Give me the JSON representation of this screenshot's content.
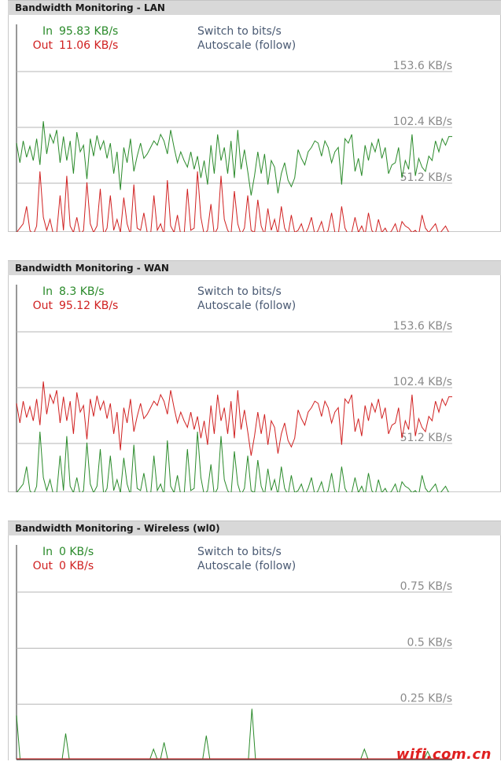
{
  "panels": [
    {
      "title": "Bandwidth Monitoring - LAN",
      "in_label": "In",
      "in_value": "95.83 KB/s",
      "out_label": "Out",
      "out_value": "11.06 KB/s",
      "switch_link": "Switch to bits/s",
      "autoscale_link": "Autoscale (follow)",
      "chart_data": {
        "type": "line",
        "yticks": [
          {
            "value": 51.2,
            "label": "51.2 KB/s"
          },
          {
            "value": 102.4,
            "label": "102.4 KB/s"
          },
          {
            "value": 153.6,
            "label": "153.6 KB/s"
          }
        ],
        "ylim": [
          0,
          153.6
        ],
        "series": [
          {
            "name": "In",
            "color": "#2a8a2a",
            "values": [
              88,
              70,
              90,
              75,
              85,
              72,
              92,
              68,
              108,
              78,
              96,
              88,
              100,
              70,
              94,
              72,
              90,
              60,
              98,
              80,
              86,
              55,
              92,
              76,
              95,
              82,
              90,
              74,
              88,
              60,
              80,
              45,
              84,
              70,
              92,
              62,
              76,
              88,
              74,
              78,
              84,
              90,
              86,
              96,
              90,
              78,
              100,
              84,
              70,
              80,
              72,
              66,
              80,
              64,
              76,
              56,
              72,
              50,
              86,
              60,
              96,
              72,
              84,
              60,
              90,
              56,
              100,
              64,
              82,
              62,
              40,
              58,
              80,
              60,
              78,
              50,
              72,
              66,
              42,
              60,
              70,
              54,
              48,
              56,
              82,
              74,
              68,
              80,
              84,
              90,
              88,
              76,
              90,
              84,
              70,
              80,
              84,
              50,
              92,
              88,
              96,
              62,
              74,
              58,
              86,
              72,
              88,
              80,
              92,
              74,
              84,
              60,
              68,
              70,
              84,
              56,
              72,
              64,
              96,
              58,
              74,
              66,
              62,
              76,
              72,
              90,
              80,
              92,
              86,
              94,
              94
            ]
          },
          {
            "name": "Out",
            "color": "#d02020",
            "values": [
              6,
              10,
              14,
              30,
              8,
              4,
              12,
              62,
              20,
              8,
              18,
              4,
              6,
              40,
              8,
              58,
              12,
              6,
              20,
              4,
              8,
              52,
              14,
              6,
              12,
              46,
              4,
              10,
              40,
              8,
              18,
              6,
              38,
              14,
              4,
              50,
              10,
              8,
              24,
              6,
              4,
              40,
              8,
              14,
              4,
              54,
              12,
              6,
              22,
              4,
              4,
              46,
              8,
              10,
              62,
              20,
              4,
              8,
              32,
              4,
              10,
              58,
              18,
              8,
              4,
              44,
              14,
              4,
              10,
              40,
              8,
              6,
              36,
              12,
              4,
              28,
              8,
              18,
              4,
              30,
              10,
              4,
              22,
              6,
              8,
              14,
              4,
              10,
              20,
              4,
              8,
              16,
              4,
              8,
              24,
              6,
              4,
              30,
              10,
              4,
              6,
              20,
              6,
              12,
              4,
              24,
              8,
              4,
              18,
              6,
              10,
              4,
              8,
              14,
              4,
              16,
              12,
              10,
              6,
              8,
              4,
              22,
              10,
              6,
              10,
              14,
              4,
              8,
              12,
              6,
              4
            ]
          }
        ]
      }
    },
    {
      "title": "Bandwidth Monitoring - WAN",
      "in_label": "In",
      "in_value": "8.3 KB/s",
      "out_label": "Out",
      "out_value": "95.12 KB/s",
      "switch_link": "Switch to bits/s",
      "autoscale_link": "Autoscale (follow)",
      "chart_data": {
        "type": "line",
        "yticks": [
          {
            "value": 51.2,
            "label": "51.2 KB/s"
          },
          {
            "value": 102.4,
            "label": "102.4 KB/s"
          },
          {
            "value": 153.6,
            "label": "153.6 KB/s"
          }
        ],
        "ylim": [
          0,
          153.6
        ],
        "series": [
          {
            "name": "In",
            "color": "#2a8a2a",
            "values": [
              6,
              10,
              14,
              30,
              8,
              4,
              12,
              62,
              20,
              8,
              18,
              4,
              6,
              40,
              8,
              58,
              12,
              6,
              20,
              4,
              8,
              52,
              14,
              6,
              12,
              46,
              4,
              10,
              40,
              8,
              18,
              6,
              38,
              14,
              4,
              50,
              10,
              8,
              24,
              6,
              4,
              40,
              8,
              14,
              4,
              54,
              12,
              6,
              22,
              4,
              4,
              46,
              8,
              10,
              62,
              20,
              4,
              8,
              32,
              4,
              10,
              58,
              18,
              8,
              4,
              44,
              14,
              4,
              10,
              40,
              8,
              6,
              36,
              12,
              4,
              28,
              8,
              18,
              4,
              30,
              10,
              4,
              22,
              6,
              8,
              14,
              4,
              10,
              20,
              4,
              8,
              16,
              4,
              8,
              24,
              6,
              4,
              30,
              10,
              4,
              6,
              20,
              6,
              12,
              4,
              24,
              8,
              4,
              18,
              6,
              10,
              4,
              8,
              14,
              4,
              16,
              12,
              10,
              6,
              8,
              4,
              22,
              10,
              6,
              10,
              14,
              4,
              8,
              12,
              6,
              4
            ]
          },
          {
            "name": "Out",
            "color": "#d02020",
            "values": [
              88,
              70,
              90,
              75,
              85,
              72,
              92,
              68,
              108,
              78,
              96,
              88,
              100,
              70,
              94,
              72,
              90,
              60,
              98,
              80,
              86,
              55,
              92,
              76,
              95,
              82,
              90,
              74,
              88,
              60,
              80,
              45,
              84,
              70,
              92,
              62,
              76,
              88,
              74,
              78,
              84,
              90,
              86,
              96,
              90,
              78,
              100,
              84,
              70,
              80,
              72,
              66,
              80,
              64,
              76,
              56,
              72,
              50,
              86,
              60,
              96,
              72,
              84,
              60,
              90,
              56,
              100,
              64,
              82,
              62,
              40,
              58,
              80,
              60,
              78,
              50,
              72,
              66,
              42,
              60,
              70,
              54,
              48,
              56,
              82,
              74,
              68,
              80,
              84,
              90,
              88,
              76,
              90,
              84,
              70,
              80,
              84,
              50,
              92,
              88,
              96,
              62,
              74,
              58,
              86,
              72,
              88,
              80,
              92,
              74,
              84,
              60,
              68,
              70,
              84,
              56,
              72,
              64,
              96,
              58,
              74,
              66,
              62,
              76,
              72,
              90,
              80,
              92,
              86,
              94,
              94
            ]
          }
        ]
      }
    },
    {
      "title": "Bandwidth Monitoring - Wireless (wl0)",
      "in_label": "In",
      "in_value": "0 KB/s",
      "out_label": "Out",
      "out_value": "0 KB/s",
      "switch_link": "Switch to bits/s",
      "autoscale_link": "Autoscale (follow)",
      "chart_data": {
        "type": "line",
        "yticks": [
          {
            "value": 0.25,
            "label": "0.25 KB/s"
          },
          {
            "value": 0.5,
            "label": "0.5 KB/s"
          },
          {
            "value": 0.75,
            "label": "0.75 KB/s"
          }
        ],
        "ylim": [
          0,
          0.75
        ],
        "series": [
          {
            "name": "In",
            "color": "#2a8a2a",
            "values": [
              0.2,
              0,
              0,
              0,
              0,
              0,
              0,
              0,
              0,
              0,
              0,
              0,
              0,
              0,
              0.12,
              0,
              0,
              0,
              0,
              0,
              0,
              0,
              0,
              0,
              0,
              0,
              0,
              0,
              0,
              0,
              0,
              0,
              0,
              0,
              0,
              0,
              0,
              0,
              0,
              0.05,
              0,
              0,
              0.08,
              0,
              0,
              0,
              0,
              0,
              0,
              0,
              0,
              0,
              0,
              0,
              0.11,
              0,
              0,
              0,
              0,
              0,
              0,
              0,
              0,
              0,
              0,
              0,
              0,
              0.23,
              0,
              0,
              0,
              0,
              0,
              0,
              0,
              0,
              0,
              0,
              0,
              0,
              0,
              0,
              0,
              0,
              0,
              0,
              0,
              0,
              0,
              0,
              0,
              0,
              0,
              0,
              0,
              0,
              0,
              0,
              0,
              0.05,
              0,
              0,
              0,
              0,
              0,
              0,
              0,
              0,
              0,
              0,
              0,
              0,
              0,
              0,
              0,
              0,
              0,
              0.04,
              0,
              0,
              0,
              0,
              0,
              0,
              0
            ]
          },
          {
            "name": "Out",
            "color": "#d02020",
            "values": [
              0,
              0,
              0,
              0,
              0,
              0,
              0,
              0,
              0,
              0,
              0,
              0,
              0,
              0,
              0,
              0,
              0,
              0,
              0,
              0,
              0,
              0,
              0,
              0,
              0,
              0,
              0,
              0,
              0,
              0,
              0,
              0,
              0,
              0,
              0,
              0,
              0,
              0,
              0,
              0,
              0,
              0,
              0,
              0,
              0,
              0,
              0,
              0,
              0,
              0,
              0,
              0,
              0,
              0,
              0,
              0,
              0,
              0,
              0,
              0,
              0,
              0,
              0,
              0,
              0,
              0,
              0,
              0,
              0,
              0,
              0,
              0,
              0,
              0,
              0,
              0,
              0,
              0,
              0,
              0,
              0,
              0,
              0,
              0,
              0,
              0,
              0,
              0,
              0,
              0,
              0,
              0,
              0,
              0,
              0,
              0,
              0,
              0,
              0,
              0,
              0,
              0,
              0,
              0,
              0,
              0,
              0,
              0,
              0,
              0,
              0,
              0,
              0,
              0,
              0,
              0,
              0,
              0,
              0,
              0,
              0,
              0,
              0
            ]
          }
        ]
      }
    }
  ],
  "watermark": "wifi.com.cn"
}
